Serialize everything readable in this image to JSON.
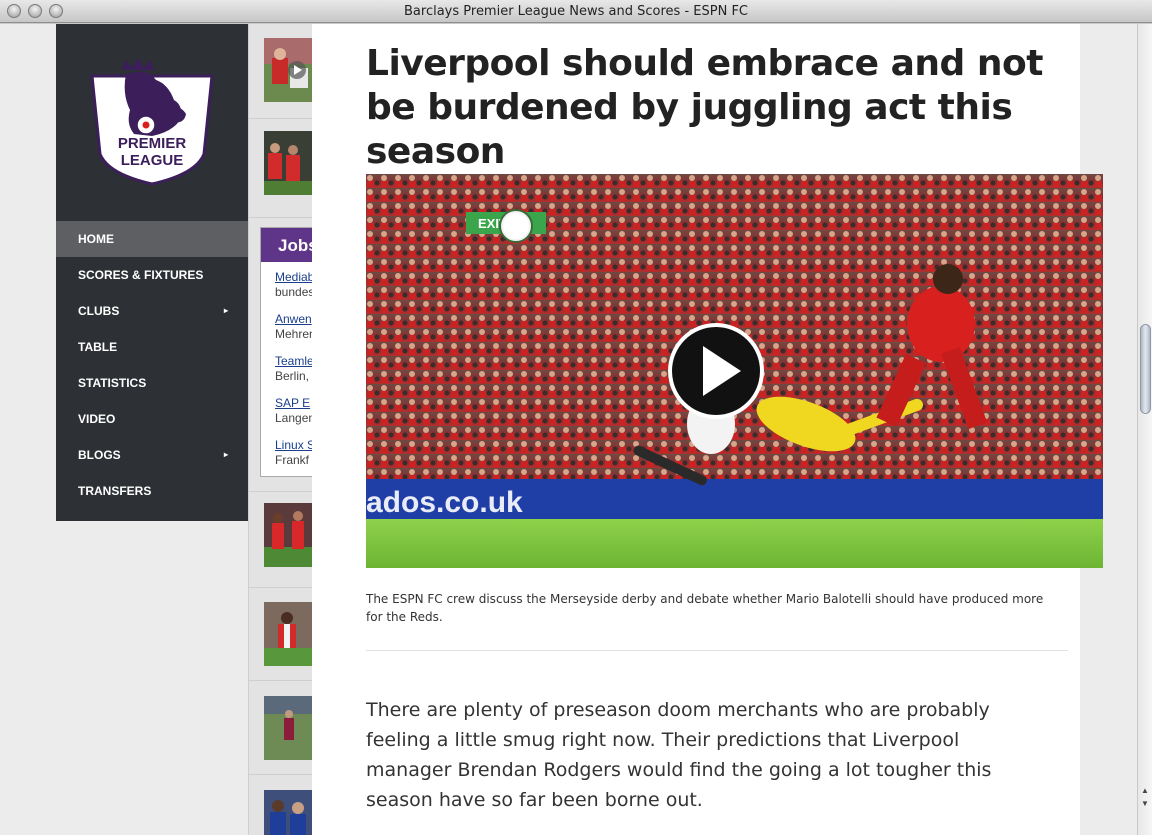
{
  "window": {
    "title": "Barclays Premier League News and Scores - ESPN FC"
  },
  "logo": {
    "line1": "PREMIER",
    "line2": "LEAGUE"
  },
  "nav": {
    "items": [
      {
        "label": "HOME",
        "active": true,
        "submenu": false
      },
      {
        "label": "SCORES & FIXTURES",
        "active": false,
        "submenu": false
      },
      {
        "label": "CLUBS",
        "active": false,
        "submenu": true
      },
      {
        "label": "TABLE",
        "active": false,
        "submenu": false
      },
      {
        "label": "STATISTICS",
        "active": false,
        "submenu": false
      },
      {
        "label": "VIDEO",
        "active": false,
        "submenu": false
      },
      {
        "label": "BLOGS",
        "active": false,
        "submenu": true
      },
      {
        "label": "TRANSFERS",
        "active": false,
        "submenu": false
      }
    ],
    "submenu_caret": "▸"
  },
  "jobs": {
    "title": "Jobs",
    "items": [
      {
        "link": "Mediab",
        "sub": "bundes"
      },
      {
        "link": "Anwen",
        "sub": "Mehren"
      },
      {
        "link": "Teamle",
        "sub": "Berlin,"
      },
      {
        "link": "SAP E",
        "sub": "Langen"
      },
      {
        "link": "Linux S",
        "sub": "Frankf"
      }
    ]
  },
  "article": {
    "headline": "Liverpool should embrace and not be burdened by juggling act this season",
    "video_caption": "The ESPN FC crew discuss the Merseyside derby and debate whether Mario Balotelli should have produced more for the Reds.",
    "body": "There are plenty of preseason doom merchants who are probably feeling a little smug right now. Their predictions that Liverpool manager Brendan Rodgers would find the going a lot tougher this season have so far been borne out.",
    "hero_board_text": "ados.co.uk",
    "hero_exit_sign": "EXIT"
  },
  "colors": {
    "nav_bg": "#2d3035",
    "nav_active": "#5d5f63",
    "jobs_header": "#5e3588",
    "liverpool_red": "#d9201e",
    "pitch_green": "#7cc940"
  },
  "icons": {
    "play": "play-icon",
    "caret": "chevron-right-icon",
    "logo": "premier-league-lion-logo"
  }
}
